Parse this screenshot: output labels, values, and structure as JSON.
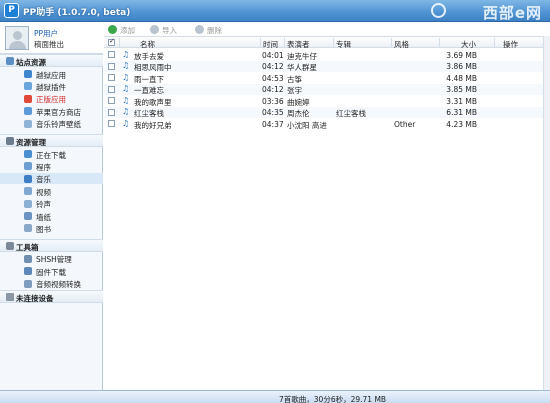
{
  "window": {
    "title": "PP助手 (1.0.7.0, beta)",
    "logo_letter": "P",
    "watermark": "西部e网"
  },
  "sidebar": {
    "user": {
      "name": "PP用户",
      "logout": "稿面推出"
    },
    "sections": [
      {
        "title": "站点资源",
        "icon": "home-icon",
        "items": [
          {
            "label": "越狱应用",
            "icon": "app-icon"
          },
          {
            "label": "越狱插件",
            "icon": "plugin-icon"
          },
          {
            "label": "正版应用",
            "icon": "apple-icon",
            "highlight": true
          },
          {
            "label": "苹果官方商店",
            "icon": "store-icon"
          },
          {
            "label": "音乐铃声壁纸",
            "icon": "music-icon"
          }
        ]
      },
      {
        "title": "资源管理",
        "icon": "gear-icon",
        "items": [
          {
            "label": "正在下载",
            "icon": "download-icon"
          },
          {
            "label": "程序",
            "icon": "program-icon"
          },
          {
            "label": "音乐",
            "icon": "music-note-icon",
            "active": true
          },
          {
            "label": "视频",
            "icon": "video-icon"
          },
          {
            "label": "铃声",
            "icon": "ringtone-icon"
          },
          {
            "label": "墙纸",
            "icon": "wallpaper-icon"
          },
          {
            "label": "图书",
            "icon": "book-icon"
          }
        ]
      },
      {
        "title": "工具箱",
        "icon": "toolbox-icon",
        "items": [
          {
            "label": "SHSH管理",
            "icon": "shsh-icon"
          },
          {
            "label": "固件下载",
            "icon": "firmware-icon"
          },
          {
            "label": "音频视频转换",
            "icon": "convert-icon"
          }
        ]
      }
    ],
    "device": "未连接设备"
  },
  "toolbar": {
    "add": "添加",
    "import": "导入",
    "delete": "删除"
  },
  "table": {
    "columns": [
      "名称",
      "时间",
      "表演者",
      "专辑",
      "风格",
      "大小",
      "操作"
    ],
    "rows": [
      {
        "name": "放手去爱",
        "time": "04:01",
        "artist": "迪克牛仔",
        "album": "",
        "genre": "",
        "size": "3.69 MB"
      },
      {
        "name": "相思风雨中",
        "time": "04:12",
        "artist": "华人群星",
        "album": "",
        "genre": "",
        "size": "3.86 MB"
      },
      {
        "name": "雨一直下",
        "time": "04:53",
        "artist": "古筝",
        "album": "",
        "genre": "",
        "size": "4.48 MB"
      },
      {
        "name": "一直难忘",
        "time": "04:12",
        "artist": "张宇",
        "album": "",
        "genre": "",
        "size": "3.85 MB"
      },
      {
        "name": "我的歌声里",
        "time": "03:36",
        "artist": "曲婉婷",
        "album": "",
        "genre": "",
        "size": "3.31 MB"
      },
      {
        "name": "红尘客栈",
        "time": "04:35",
        "artist": "周杰伦",
        "album": "红尘客栈",
        "genre": "",
        "size": "6.31 MB"
      },
      {
        "name": "我的好兄弟",
        "time": "04:37",
        "artist": "小沈阳 高进",
        "album": "",
        "genre": "Other",
        "size": "4.23 MB"
      }
    ]
  },
  "status": "7首歌曲，30分6秒，29.71 MB",
  "colors": {
    "titlebar": "#4f93d3",
    "highlight_red": "#d42a2a",
    "selection": "#d9e8f6",
    "link_blue": "#1a5fb4"
  }
}
